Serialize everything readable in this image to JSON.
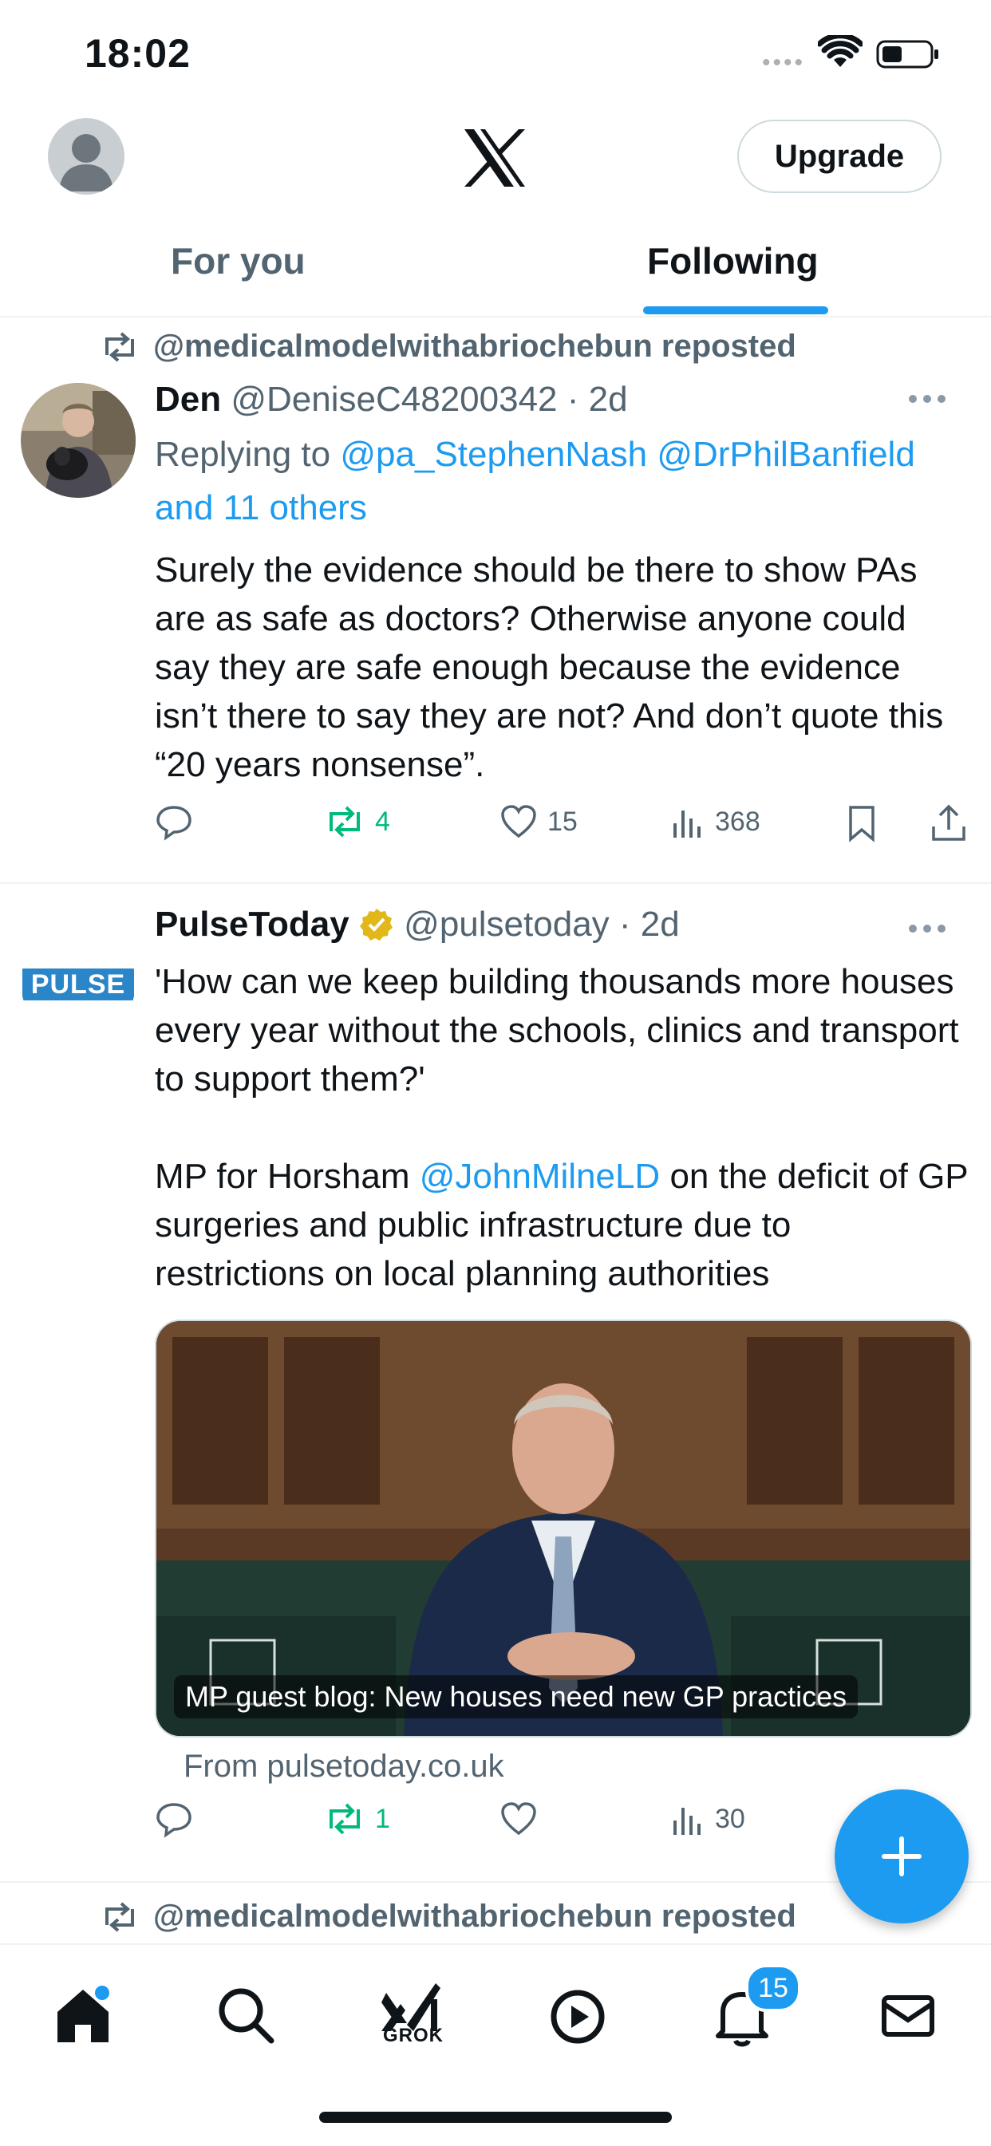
{
  "status_bar": {
    "time": "18:02"
  },
  "header": {
    "upgrade_label": "Upgrade"
  },
  "tabs": [
    {
      "label": "For you",
      "active": false
    },
    {
      "label": "Following",
      "active": true
    }
  ],
  "tweets": [
    {
      "repost_text": "@medicalmodelwithabriochebun reposted",
      "display_name": "Den",
      "handle": "@DeniseC48200342",
      "time": "· 2d",
      "replying_prefix": "Replying to",
      "replying_mentions": "@pa_StephenNash @DrPhilBanfield",
      "replying_more": "and 11 others",
      "text": "Surely the evidence should be there to show PAs are as safe as doctors? Otherwise anyone could say they are safe enough because the evidence isn’t there to say they are not? And don’t quote this “20 years nonsense”.",
      "retweets": "4",
      "likes": "15",
      "views": "368"
    },
    {
      "display_name": "PulseToday",
      "handle": "@pulsetoday",
      "time": "· 2d",
      "avatar_text": "PULSE",
      "text_line1": "'How can we keep building thousands more houses every year without the schools, clinics and transport to support them?'",
      "text_prefix": "MP for Horsham",
      "text_mention": "@JohnMilneLD",
      "text_suffix": "on the deficit of GP surgeries and public infrastructure due to restrictions on local planning authorities",
      "card_caption": "MP guest blog: New houses need new GP practices",
      "card_source": "From pulsetoday.co.uk",
      "retweets": "1",
      "views": "30"
    },
    {
      "repost_text": "@medicalmodelwithabriochebun reposted"
    }
  ],
  "bottom_nav": {
    "grok_label": "GROK",
    "notifications_count": "15"
  },
  "colors": {
    "accent": "#1d9bf0",
    "retweet_green": "#00ba7c",
    "secondary_text": "#536471"
  }
}
